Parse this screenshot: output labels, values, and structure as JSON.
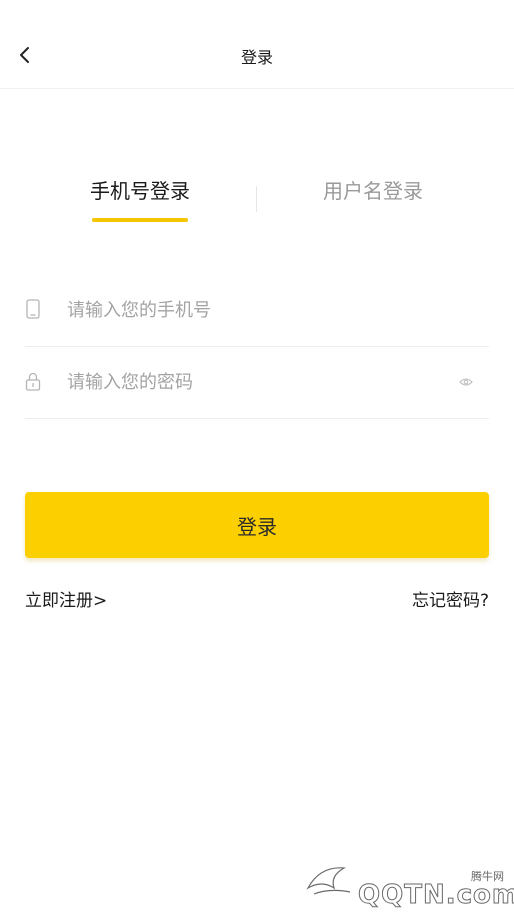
{
  "header": {
    "back_icon": "chevron-left-icon",
    "title": "登录"
  },
  "tabs": [
    {
      "label": "手机号登录",
      "active": true
    },
    {
      "label": "用户名登录",
      "active": false
    }
  ],
  "form": {
    "phone": {
      "icon": "phone-icon",
      "placeholder": "请输入您的手机号",
      "value": ""
    },
    "password": {
      "icon": "lock-icon",
      "placeholder": "请输入您的密码",
      "value": "",
      "toggle_icon": "eye-icon"
    }
  },
  "login_button": {
    "label": "登录"
  },
  "links": {
    "register": "立即注册>",
    "forgot": "忘记密码?"
  },
  "watermark": {
    "cn": "腾牛网",
    "text": "QQTN.com"
  },
  "colors": {
    "accent": "#fcd000",
    "tab_underline": "#f5c400",
    "inactive_text": "#9a9a9a",
    "placeholder": "#a3a3a3"
  }
}
